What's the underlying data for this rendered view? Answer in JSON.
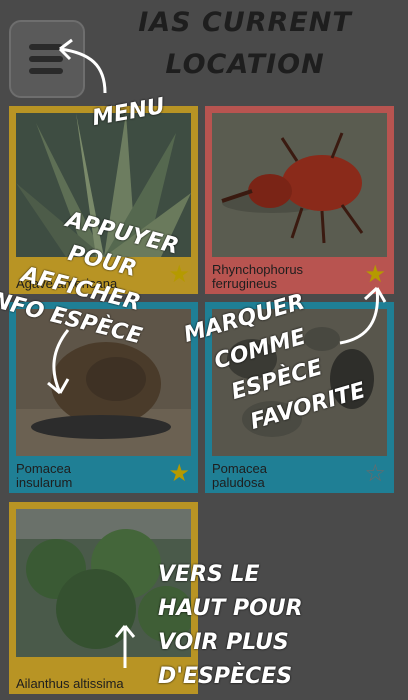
{
  "app": {
    "title_line1": "IAS CURRENT",
    "title_line2": "LOCATION"
  },
  "menu": {
    "icon": "hamburger-icon"
  },
  "species": [
    {
      "name_line1": "Agave americana",
      "name_line2": "",
      "color": "#b89424",
      "favorite": true
    },
    {
      "name_line1": "Rhynchophorus",
      "name_line2": "ferrugineus",
      "color": "#b85450",
      "favorite": true
    },
    {
      "name_line1": "Pomacea",
      "name_line2": "insularum",
      "color": "#1f7f95",
      "favorite": true
    },
    {
      "name_line1": "Pomacea",
      "name_line2": "paludosa",
      "color": "#1f7f95",
      "favorite": false
    },
    {
      "name_line1": "Ailanthus altissima",
      "name_line2": "",
      "color": "#b89424",
      "favorite": false
    }
  ],
  "hints": {
    "menu": "MENU",
    "info": [
      "APPUYER",
      "POUR",
      "AFFICHER",
      "INFO ESPÈCE"
    ],
    "favorite": [
      "MARQUER",
      "COMME",
      "ESPÈCE",
      "FAVORITE"
    ],
    "scroll": [
      "VERS LE",
      "HAUT POUR",
      "VOIR PLUS",
      "D'ESPÈCES"
    ]
  },
  "colors": {
    "star_active": "#b59a00",
    "star_inactive": "#6a6a6a"
  }
}
